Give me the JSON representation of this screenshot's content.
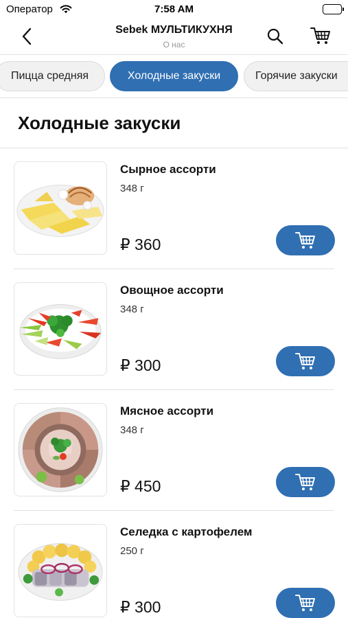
{
  "status": {
    "carrier": "Оператор",
    "time": "7:58 AM"
  },
  "nav": {
    "title": "Sebek МУЛЬТИКУХНЯ",
    "subtitle": "О нас"
  },
  "tabs": [
    {
      "label": "Пицца средняя",
      "active": false
    },
    {
      "label": "Холодные закуски",
      "active": true
    },
    {
      "label": "Горячие закуски",
      "active": false
    }
  ],
  "section": {
    "title": "Холодные закуски"
  },
  "products": [
    {
      "name": "Сырное ассорти",
      "weight": "348 г",
      "price": "₽ 360",
      "image": "cheese-platter"
    },
    {
      "name": "Овощное ассорти",
      "weight": "348 г",
      "price": "₽ 300",
      "image": "vegetable-platter"
    },
    {
      "name": "Мясное ассорти",
      "weight": "348 г",
      "price": "₽ 450",
      "image": "meat-platter"
    },
    {
      "name": "Селедка с картофелем",
      "weight": "250 г",
      "price": "₽ 300",
      "image": "herring-potato-platter"
    }
  ],
  "colors": {
    "accent": "#2f6fb2",
    "divider": "#e2e2e2",
    "tab_inactive_bg": "#f1f1f1"
  }
}
